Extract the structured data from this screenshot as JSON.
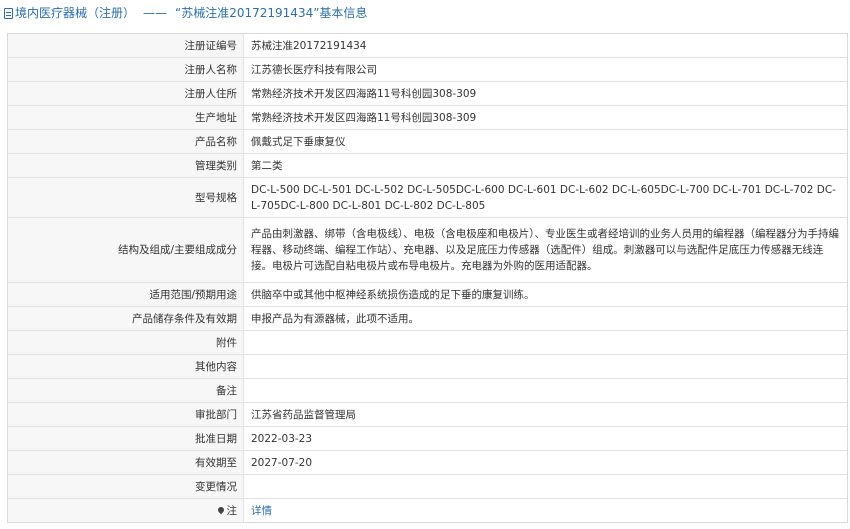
{
  "header": {
    "prefix": "境内医疗器械（注册）",
    "separator": "——",
    "title": "“苏械注准20172191434”基本信息"
  },
  "rows": [
    {
      "label": "注册证编号",
      "value": "苏械注准20172191434"
    },
    {
      "label": "注册人名称",
      "value": "江苏德长医疗科技有限公司"
    },
    {
      "label": "注册人住所",
      "value": "常熟经济技术开发区四海路11号科创园308-309"
    },
    {
      "label": "生产地址",
      "value": "常熟经济技术开发区四海路11号科创园308-309"
    },
    {
      "label": "产品名称",
      "value": "佩戴式足下垂康复仪"
    },
    {
      "label": "管理类别",
      "value": "第二类"
    },
    {
      "label": "型号规格",
      "value": "DC-L-500 DC-L-501 DC-L-502 DC-L-505DC-L-600 DC-L-601 DC-L-602 DC-L-605DC-L-700 DC-L-701 DC-L-702 DC-L-705DC-L-800 DC-L-801 DC-L-802 DC-L-805"
    },
    {
      "label": "结构及组成/主要组成成分",
      "value": "产品由刺激器、绑带（含电极线）、电极（含电极座和电极片）、专业医生或者经培训的业务人员用的编程器（编程器分为手持编程器、移动终端、编程工作站）、充电器、以及足底压力传感器（选配件）组成。刺激器可以与选配件足底压力传感器无线连接。电极片可选配自粘电极片或布导电极片。充电器为外购的医用适配器。"
    },
    {
      "label": "适用范围/预期用途",
      "value": "供脑卒中或其他中枢神经系统损伤造成的足下垂的康复训练。"
    },
    {
      "label": "产品储存条件及有效期",
      "value": "申报产品为有源器械，此项不适用。"
    },
    {
      "label": "附件",
      "value": ""
    },
    {
      "label": "其他内容",
      "value": ""
    },
    {
      "label": "备注",
      "value": ""
    },
    {
      "label": "审批部门",
      "value": "江苏省药品监督管理局"
    },
    {
      "label": "批准日期",
      "value": "2022-03-23"
    },
    {
      "label": "有效期至",
      "value": "2027-07-20"
    },
    {
      "label": "变更情况",
      "value": ""
    },
    {
      "label": "注",
      "value": "详情"
    }
  ]
}
